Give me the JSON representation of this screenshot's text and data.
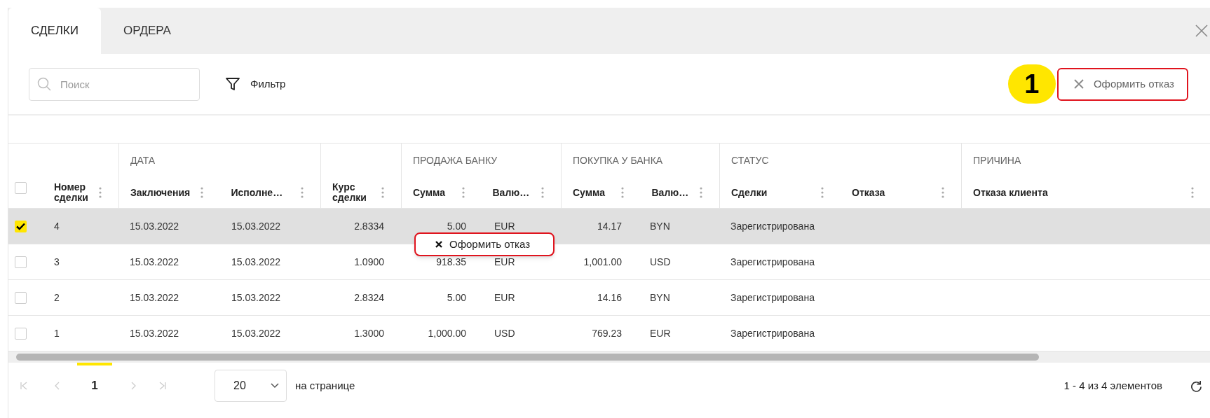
{
  "tabs": [
    {
      "label": "СДЕЛКИ",
      "selected": true
    },
    {
      "label": "ОРДЕРА",
      "selected": false
    }
  ],
  "search": {
    "placeholder": "Поиск"
  },
  "filter": {
    "label": "Фильтр"
  },
  "callout": {
    "label": "1"
  },
  "action_button": {
    "label": "Оформить отказ"
  },
  "table": {
    "select_all": {
      "checked": false
    },
    "columns": [
      {
        "label": "Номер сделки",
        "in_group": false
      },
      {
        "label": "Заключения",
        "group": "ДАТА",
        "in_group": true
      },
      {
        "label": "Исполне…",
        "in_group": true
      },
      {
        "label": "Курс сделки",
        "in_group": false
      },
      {
        "label": "Сумма",
        "group": "ПРОДАЖА БАНКУ",
        "in_group": true
      },
      {
        "label": "Валю…",
        "in_group": true
      },
      {
        "label": "Сумма",
        "group": "ПОКУПКА У БАНКА",
        "in_group": true
      },
      {
        "label": "Валю…",
        "in_group": true
      },
      {
        "label": "Сделки",
        "group": "СТАТУС",
        "in_group": true
      },
      {
        "label": "Отказа",
        "in_group": true
      },
      {
        "label": "Отказа клиента",
        "group": "ПРИЧИНА",
        "in_group": true
      }
    ],
    "rows": [
      {
        "selected": true,
        "cells": [
          "4",
          "15.03.2022",
          "15.03.2022",
          "2.8334",
          "5.00",
          "EUR",
          "14.17",
          "BYN",
          "Зарегистрирована"
        ]
      },
      {
        "selected": false,
        "cells": [
          "3",
          "15.03.2022",
          "15.03.2022",
          "1.0900",
          "918.35",
          "EUR",
          "1,001.00",
          "USD",
          "Зарегистрирована"
        ]
      },
      {
        "selected": false,
        "cells": [
          "2",
          "15.03.2022",
          "15.03.2022",
          "2.8324",
          "5.00",
          "EUR",
          "14.16",
          "BYN",
          "Зарегистрирована"
        ]
      },
      {
        "selected": false,
        "cells": [
          "1",
          "15.03.2022",
          "15.03.2022",
          "1.3000",
          "1,000.00",
          "USD",
          "769.23",
          "EUR",
          "Зарегистрирована"
        ]
      }
    ]
  },
  "context_menu": {
    "items": [
      {
        "label": "Оформить отказ"
      }
    ]
  },
  "pagination": {
    "pages": [
      {
        "label": "1",
        "selected": true
      }
    ],
    "page_size": "20",
    "per_page_label": "на странице",
    "summary": "1 - 4 из 4 элементов"
  }
}
